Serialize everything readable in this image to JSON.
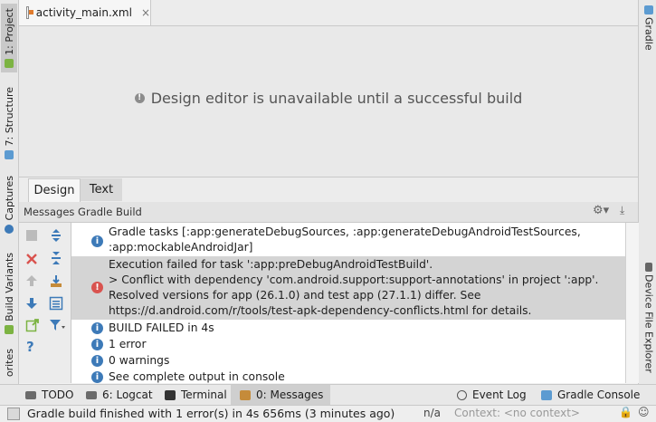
{
  "editor": {
    "tab_label": "activity_main.xml",
    "tab_close": "×",
    "unavailable_message": "Design editor is unavailable until a successful build"
  },
  "left_tabs": [
    {
      "label": "1: Project",
      "icon": "android-project-icon"
    },
    {
      "label": "7: Structure",
      "icon": "structure-icon"
    },
    {
      "label": "Captures",
      "icon": "captures-icon"
    },
    {
      "label": "Build Variants",
      "icon": "android-icon"
    },
    {
      "label": "orites",
      "icon": "star-icon"
    }
  ],
  "right_tabs": [
    {
      "label": "Gradle",
      "icon": "gradle-icon"
    },
    {
      "label": "Device File Explorer",
      "icon": "device-icon"
    }
  ],
  "design_tabs": {
    "design": "Design",
    "text": "Text"
  },
  "messages": {
    "header_title": "Messages Gradle Build",
    "items": [
      {
        "type": "info",
        "lines": "Gradle tasks [:app:generateDebugSources, :app:generateDebugAndroidTestSources,\n:app:mockableAndroidJar]"
      },
      {
        "type": "error",
        "lines": "Execution failed for task ':app:preDebugAndroidTestBuild'.\n> Conflict with dependency 'com.android.support:support-annotations' in project ':app'.\nResolved versions for app (26.1.0) and test app (27.1.1) differ. See\nhttps://d.android.com/r/tools/test-apk-dependency-conflicts.html for details."
      },
      {
        "type": "info",
        "lines": "BUILD FAILED in 4s"
      },
      {
        "type": "info",
        "lines": "1 error"
      },
      {
        "type": "info",
        "lines": "0 warnings"
      },
      {
        "type": "info",
        "lines": "See complete output in console"
      }
    ]
  },
  "bottom_bar": {
    "todo": "TODO",
    "logcat": "6: Logcat",
    "terminal": "Terminal",
    "messages": "0: Messages",
    "event_log": "Event Log",
    "gradle_console": "Gradle Console"
  },
  "status_bar": {
    "message": "Gradle build finished with 1 error(s) in 4s 656ms (3 minutes ago)",
    "position": "n/a",
    "context": "Context: <no context>"
  },
  "colors": {
    "error": "#d9534f",
    "info": "#3d7ab8",
    "selected_row": "#d4d4d4",
    "android_green": "#7cb342"
  }
}
